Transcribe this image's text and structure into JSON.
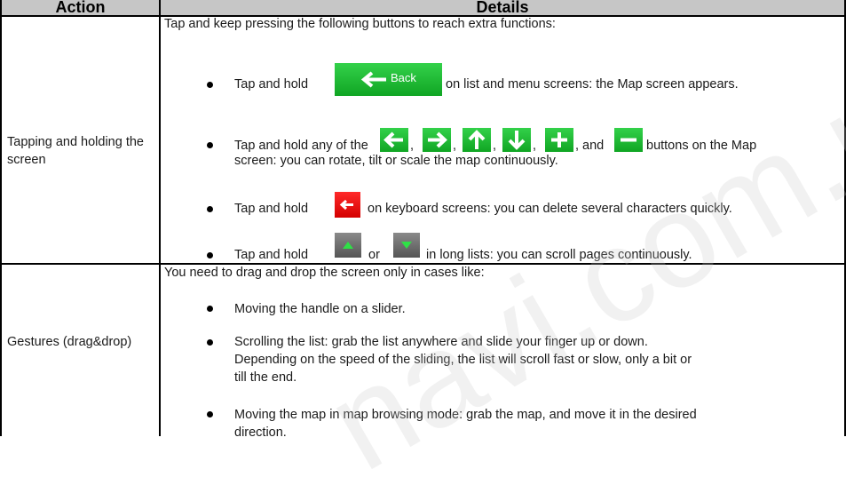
{
  "table": {
    "headers": {
      "action": "Action",
      "details": "Details"
    },
    "rows": [
      {
        "action": "Tapping and holding the screen",
        "intro": "Tap and keep pressing the following buttons to reach extra functions:",
        "items": [
          {
            "pre": "Tap and hold",
            "post": "on list and menu screens: the Map screen appears."
          },
          {
            "pre": "Tap and hold any of the",
            "mid1": ",",
            "mid2": ",",
            "mid3": ",",
            "mid4": ",",
            "and": ", and",
            "post": "buttons on the Map",
            "post2": "screen: you can rotate, tilt or scale the map continuously."
          },
          {
            "pre": "Tap and hold",
            "post": "on keyboard screens: you can delete several characters quickly."
          },
          {
            "pre": "Tap and hold",
            "or": "or",
            "post": "in long lists: you can scroll pages continuously."
          }
        ],
        "back_label": "Back"
      },
      {
        "action": "Gestures (drag&drop)",
        "intro": "You need to drag and drop the screen only in cases like:",
        "items": [
          "Moving the handle on a slider.",
          "Scrolling the list: grab the list anywhere and slide your finger up or down.",
          "Depending on the speed of the sliding, the list will scroll fast or slow, only a bit or",
          "till the end.",
          "Moving the map in map browsing mode: grab the map, and move it in the desired",
          "direction."
        ]
      }
    ]
  },
  "colors": {
    "header_bg": "#c6c6c6",
    "border": "#000000",
    "button_green": "#1fbf34",
    "button_red": "#e60000"
  },
  "watermark": "navi.com.ua"
}
